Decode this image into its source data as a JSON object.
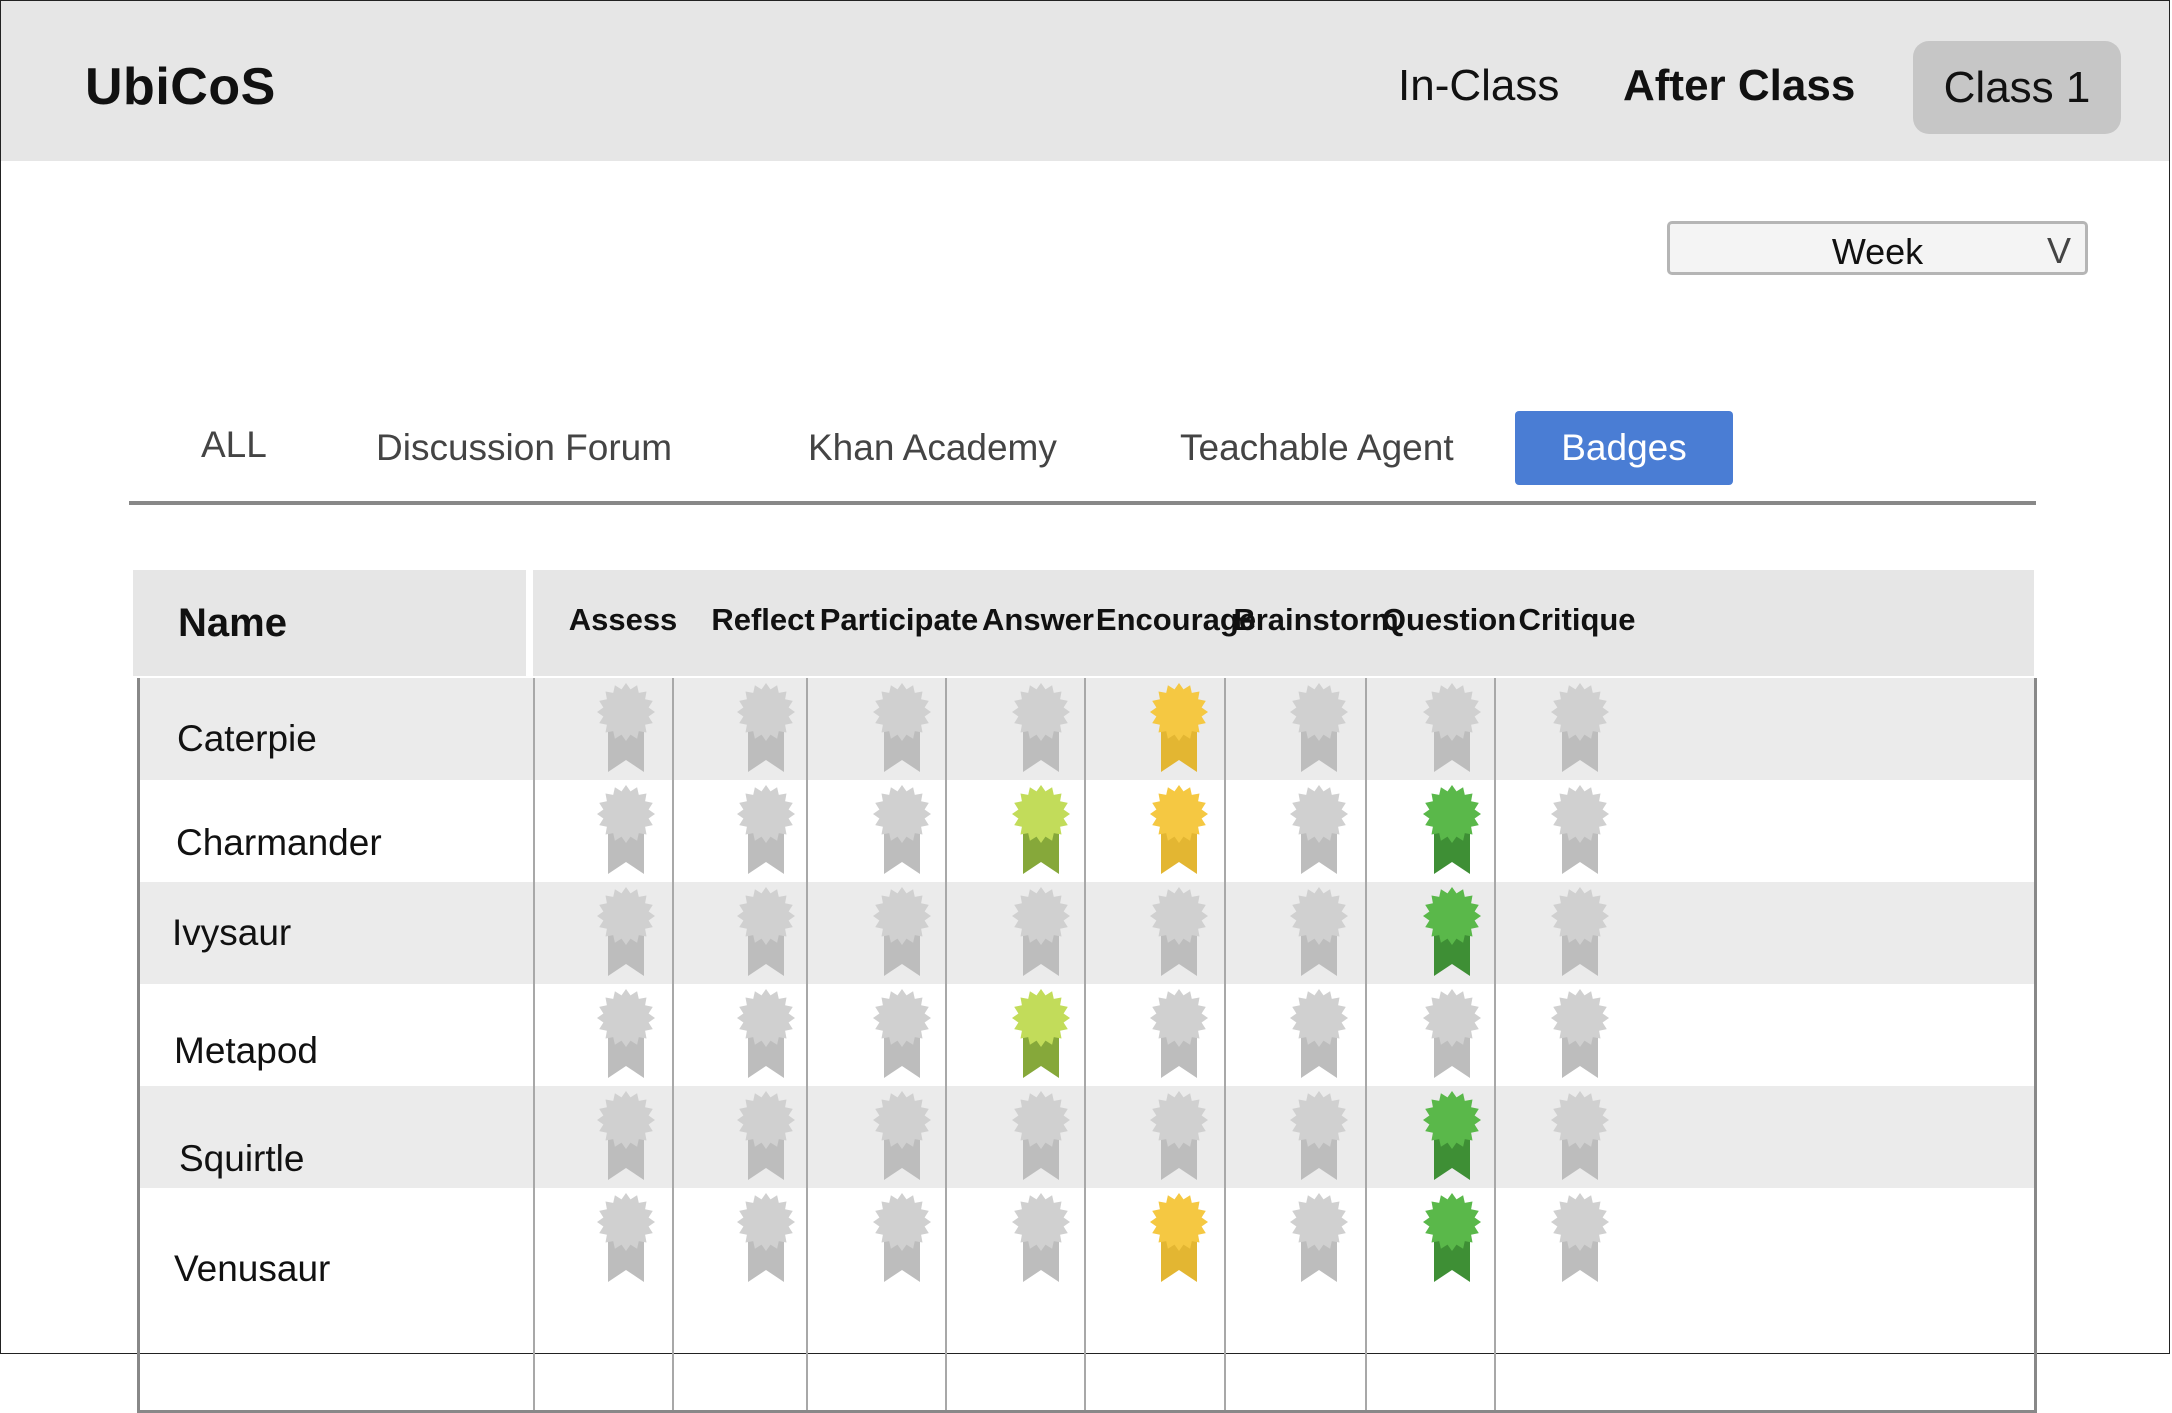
{
  "app": {
    "title": "UbiCoS"
  },
  "nav": {
    "in_class": "In-Class",
    "after_class": "After Class",
    "class_button": "Class 1"
  },
  "filter": {
    "selected": "Week",
    "chevron": "V"
  },
  "tabs": [
    {
      "label": "ALL",
      "active": false
    },
    {
      "label": "Discussion Forum",
      "active": false
    },
    {
      "label": "Khan Academy",
      "active": false
    },
    {
      "label": "Teachable Agent",
      "active": false
    },
    {
      "label": "Badges",
      "active": true
    }
  ],
  "table": {
    "name_header": "Name",
    "columns": [
      "Assess",
      "Reflect",
      "Participate",
      "Answer",
      "Encourage",
      "Brainstorm",
      "Question",
      "Critique"
    ],
    "rows": [
      {
        "name": "Caterpie",
        "badges": [
          "none",
          "none",
          "none",
          "none",
          "gold",
          "none",
          "none",
          "none"
        ]
      },
      {
        "name": "Charmander",
        "badges": [
          "none",
          "none",
          "none",
          "lime",
          "gold",
          "none",
          "green",
          "none"
        ]
      },
      {
        "name": "Ivysaur",
        "badges": [
          "none",
          "none",
          "none",
          "none",
          "none",
          "none",
          "green",
          "none"
        ]
      },
      {
        "name": "Metapod",
        "badges": [
          "none",
          "none",
          "none",
          "lime",
          "none",
          "none",
          "none",
          "none"
        ]
      },
      {
        "name": "Squirtle",
        "badges": [
          "none",
          "none",
          "none",
          "none",
          "none",
          "none",
          "green",
          "none"
        ]
      },
      {
        "name": "Venusaur",
        "badges": [
          "none",
          "none",
          "none",
          "none",
          "gold",
          "none",
          "green",
          "none"
        ]
      }
    ]
  },
  "badge_colors": {
    "none": {
      "top": "#d0d0d0",
      "ribbon": "#bdbdbd"
    },
    "gold": {
      "top": "#f5c842",
      "ribbon": "#e3b632"
    },
    "lime": {
      "top": "#c2dc5a",
      "ribbon": "#86a83a"
    },
    "green": {
      "top": "#5ab84a",
      "ribbon": "#3e8f35"
    }
  },
  "accent": "#4a7dd4"
}
